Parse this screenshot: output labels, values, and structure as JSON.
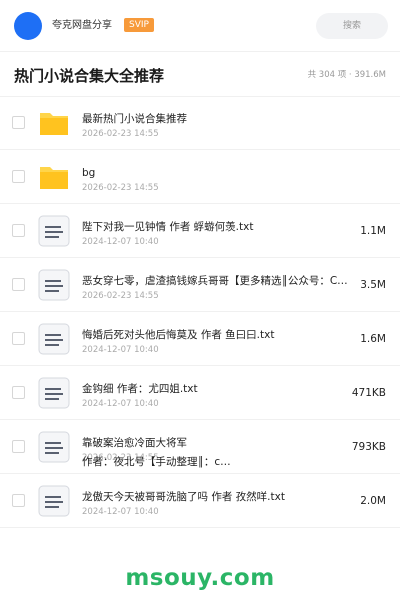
{
  "header": {
    "username": "夸克网盘分享",
    "badge": "SVIP",
    "search_placeholder": "搜索"
  },
  "title": "热门小说合集大全推荐",
  "count": "共 304 项 · 391.6M",
  "files": [
    {
      "type": "folder",
      "name": "最新热门小说合集推荐",
      "date": "2026-02-23 14:55",
      "size": ""
    },
    {
      "type": "folder",
      "name": "bg",
      "date": "2026-02-23 14:55",
      "size": ""
    },
    {
      "type": "txt",
      "name": "陛下对我一见钟情 作者 蜉蝣何羡.txt",
      "date": "2024-12-07 10:40",
      "size": "1.1M"
    },
    {
      "type": "txt",
      "name": "恶女穿七零，虐渣搞钱嫁兵哥哥【更多精选║公众号：C…",
      "date": "2026-02-23 14:55",
      "size": "3.5M"
    },
    {
      "type": "txt",
      "name": "悔婚后死对头他后悔莫及 作者 鱼曰曰.txt",
      "date": "2024-12-07 10:40",
      "size": "1.6M"
    },
    {
      "type": "txt",
      "name": "金钩细 作者：尤四姐.txt",
      "date": "2024-12-07 10:40",
      "size": "471KB"
    },
    {
      "type": "txt",
      "name": "靠破案治愈冷面大将军",
      "name2": "作者：夜北号【手动整理║：c…",
      "date": "2026-02-23 14:55",
      "size": "793KB"
    },
    {
      "type": "txt",
      "name": "龙傲天今天被哥哥洗脑了吗 作者 孜然咩.txt",
      "date": "2024-12-07 10:40",
      "size": "2.0M"
    }
  ],
  "watermark": "msouy.com",
  "colors": {
    "accent": "#1e6ff5",
    "svip": "#f79a3a",
    "folder": "#ffc31f",
    "watermark": "#2bb566"
  }
}
